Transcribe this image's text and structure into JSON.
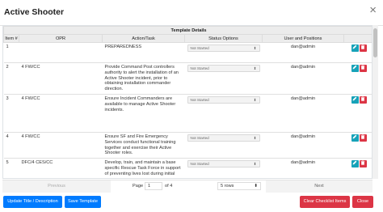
{
  "modal": {
    "title": "Active Shooter",
    "close_glyph": "×"
  },
  "table": {
    "group_header": "Template Details",
    "columns": [
      "Item #",
      "OPR",
      "Action/Task",
      "Status Options",
      "User and Positions"
    ],
    "rows": [
      {
        "item": "1",
        "opr": "",
        "task": "PREPAREDNESS",
        "status": "Not Started",
        "user": "dan@admin"
      },
      {
        "item": "2",
        "opr": "4 FW/CC",
        "task": "Provide Command Post controllers authority to alert the installation of an Active Shooter incident, prior to obtaining installation commander direction.",
        "status": "Not Started",
        "user": "dan@admin"
      },
      {
        "item": "3",
        "opr": "4 FW/CC",
        "task": "Ensure Incident Commanders are available to manage Active Shooter incidents.",
        "status": "Not Started",
        "user": "dan@admin"
      },
      {
        "item": "4",
        "opr": "4 FW/CC",
        "task": "Ensure SF and Fire Emergency Services conduct functional training together and exercise their Active Shooter roles.",
        "status": "Not Started",
        "user": "dan@admin"
      },
      {
        "item": "5",
        "opr": "DFC/4 CES/CC",
        "task": "Develop, train, and maintain a base specific Rescue Task Force in support of preventing lives lost during initial response.",
        "status": "Not Started",
        "user": "dan@admin"
      }
    ],
    "status_caret": "⬍",
    "edit_icon": "pencil-icon",
    "delete_icon": "trash-icon"
  },
  "pagination": {
    "previous_label": "Previous",
    "next_label": "Next",
    "page_label": "Page",
    "page_value": "1",
    "of_label": "of 4",
    "rows_value": "5 rows",
    "rows_caret": "⬍"
  },
  "footer": {
    "update_label": "Update Title / Description",
    "save_label": "Save Template",
    "clear_label": "Clear Checklist Items",
    "close_label": "Close"
  },
  "colors": {
    "primary": "#007bff",
    "danger": "#dc3545",
    "info": "#17a2b8"
  }
}
